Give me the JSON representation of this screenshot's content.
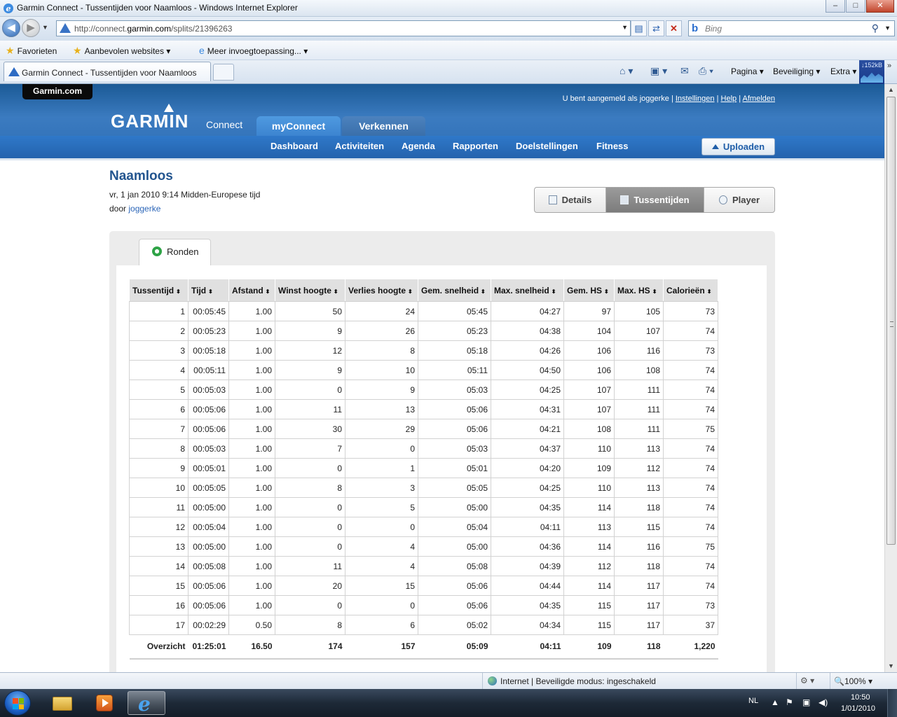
{
  "window": {
    "title": "Garmin Connect - Tussentijden voor Naamloos - Windows Internet Explorer",
    "min": "–",
    "max": "□",
    "close": "✕"
  },
  "address": {
    "url_pre": "http://connect.",
    "url_domain": "garmin.com",
    "url_post": "/splits/21396263",
    "search_placeholder": "Bing"
  },
  "favorites": {
    "favorites_label": "Favorieten",
    "suggested_label": "Aanbevolen websites ▾",
    "addons_label": "Meer invoegtoepassing... ▾"
  },
  "tab": {
    "title": "Garmin Connect - Tussentijden voor Naamloos"
  },
  "commandbar": {
    "page": "Pagina ▾",
    "safety": "Beveiliging ▾",
    "tools": "Extra ▾",
    "net_rate": "↓152kB"
  },
  "site": {
    "garmin_com": "Garmin.com",
    "logo": "GARMIN",
    "logo_connect": "Connect",
    "logged_in_as": "U bent aangemeld als joggerke",
    "link_settings": "Instellingen",
    "link_help": "Help",
    "link_logout": "Afmelden",
    "tab_myconnect": "myConnect",
    "tab_explore": "Verkennen",
    "nav": [
      "Dashboard",
      "Activiteiten",
      "Agenda",
      "Rapporten",
      "Doelstellingen",
      "Fitness"
    ],
    "upload": "Uploaden"
  },
  "activity": {
    "title": "Naamloos",
    "date": "vr, 1 jan 2010 9:14 Midden-Europese tijd",
    "by_prefix": "door ",
    "by_user": "joggerke"
  },
  "views": {
    "details": "Details",
    "splits": "Tussentijden",
    "player": "Player"
  },
  "panel": {
    "tab_laps": "Ronden"
  },
  "table": {
    "headers": [
      "Tussentijd",
      "Tijd",
      "Afstand",
      "Winst hoogte",
      "Verlies hoogte",
      "Gem. snelheid",
      "Max. snelheid",
      "Gem. HS",
      "Max. HS",
      "Calorieën"
    ],
    "sort_glyph": "⬍",
    "rows": [
      [
        "1",
        "00:05:45",
        "1.00",
        "50",
        "24",
        "05:45",
        "04:27",
        "97",
        "105",
        "73"
      ],
      [
        "2",
        "00:05:23",
        "1.00",
        "9",
        "26",
        "05:23",
        "04:38",
        "104",
        "107",
        "74"
      ],
      [
        "3",
        "00:05:18",
        "1.00",
        "12",
        "8",
        "05:18",
        "04:26",
        "106",
        "116",
        "73"
      ],
      [
        "4",
        "00:05:11",
        "1.00",
        "9",
        "10",
        "05:11",
        "04:50",
        "106",
        "108",
        "74"
      ],
      [
        "5",
        "00:05:03",
        "1.00",
        "0",
        "9",
        "05:03",
        "04:25",
        "107",
        "111",
        "74"
      ],
      [
        "6",
        "00:05:06",
        "1.00",
        "11",
        "13",
        "05:06",
        "04:31",
        "107",
        "111",
        "74"
      ],
      [
        "7",
        "00:05:06",
        "1.00",
        "30",
        "29",
        "05:06",
        "04:21",
        "108",
        "111",
        "75"
      ],
      [
        "8",
        "00:05:03",
        "1.00",
        "7",
        "0",
        "05:03",
        "04:37",
        "110",
        "113",
        "74"
      ],
      [
        "9",
        "00:05:01",
        "1.00",
        "0",
        "1",
        "05:01",
        "04:20",
        "109",
        "112",
        "74"
      ],
      [
        "10",
        "00:05:05",
        "1.00",
        "8",
        "3",
        "05:05",
        "04:25",
        "110",
        "113",
        "74"
      ],
      [
        "11",
        "00:05:00",
        "1.00",
        "0",
        "5",
        "05:00",
        "04:35",
        "114",
        "118",
        "74"
      ],
      [
        "12",
        "00:05:04",
        "1.00",
        "0",
        "0",
        "05:04",
        "04:11",
        "113",
        "115",
        "74"
      ],
      [
        "13",
        "00:05:00",
        "1.00",
        "0",
        "4",
        "05:00",
        "04:36",
        "114",
        "116",
        "75"
      ],
      [
        "14",
        "00:05:08",
        "1.00",
        "11",
        "4",
        "05:08",
        "04:39",
        "112",
        "118",
        "74"
      ],
      [
        "15",
        "00:05:06",
        "1.00",
        "20",
        "15",
        "05:06",
        "04:44",
        "114",
        "117",
        "74"
      ],
      [
        "16",
        "00:05:06",
        "1.00",
        "0",
        "0",
        "05:06",
        "04:35",
        "115",
        "117",
        "73"
      ],
      [
        "17",
        "00:02:29",
        "0.50",
        "8",
        "6",
        "05:02",
        "04:34",
        "115",
        "117",
        "37"
      ]
    ],
    "total": [
      "Overzicht",
      "01:25:01",
      "16.50",
      "174",
      "157",
      "05:09",
      "04:11",
      "109",
      "118",
      "1,220"
    ]
  },
  "statusbar": {
    "zone": "Internet | Beveiligde modus: ingeschakeld",
    "zoom": "🔍100% ▾"
  },
  "taskbar": {
    "lang": "NL",
    "time": "10:50",
    "date": "1/01/2010"
  }
}
